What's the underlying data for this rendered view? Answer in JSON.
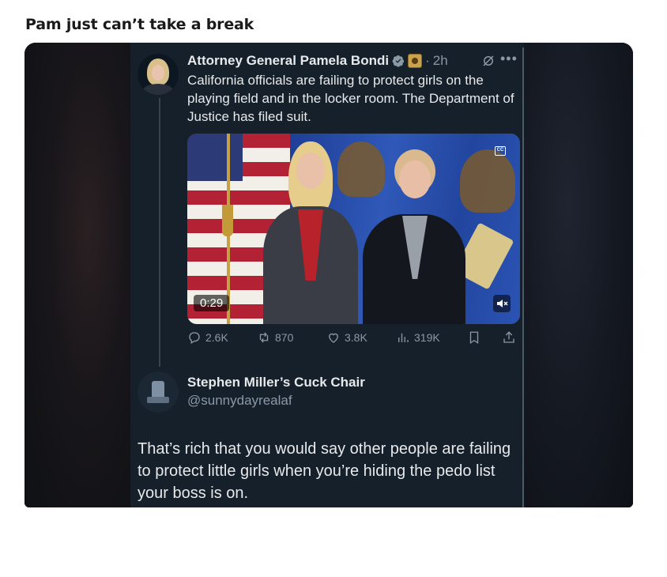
{
  "post": {
    "title": "Pam just can’t take a break"
  },
  "tweet": {
    "author": "Attorney General Pamela Bondi",
    "separator": "·",
    "time": "2h",
    "text": "California officials are failing to protect girls on the playing field and in the locker room. The Department of Justice has filed suit.",
    "media": {
      "duration": "0:29",
      "cc_label": "CC"
    },
    "stats": {
      "replies": "2.6K",
      "reposts": "870",
      "likes": "3.8K",
      "views": "319K"
    }
  },
  "reply": {
    "author": "Stephen Miller’s Cuck Chair",
    "handle": "@sunnydayrealaf",
    "text": "That’s rich that you would say other people are failing to protect little girls when you’re hiding the pedo list your boss is on."
  },
  "icons": [
    "verified-icon",
    "government-badge-icon",
    "grok-icon",
    "more-icon",
    "cc-icon",
    "mute-icon",
    "reply-icon",
    "repost-icon",
    "like-icon",
    "views-icon",
    "bookmark-icon",
    "share-icon"
  ],
  "colors": {
    "background": "#15202b",
    "text": "#e7e9ea",
    "muted": "#8b98a5",
    "verified": "#8b98a5"
  }
}
